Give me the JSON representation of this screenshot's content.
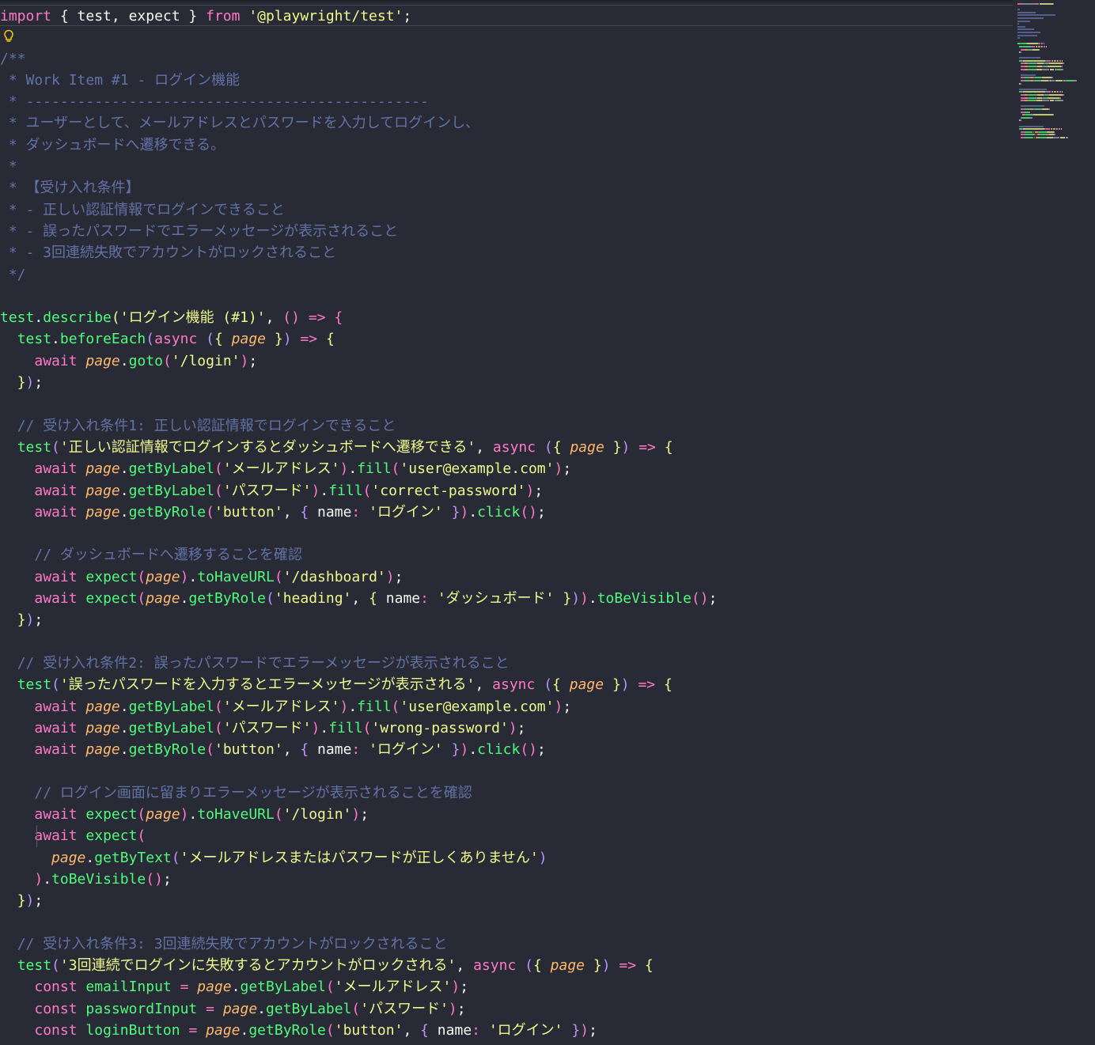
{
  "editor": {
    "language": "typescript",
    "colors": {
      "background": "#282a36",
      "comment": "#6272a4",
      "keyword": "#ff79c6",
      "string": "#f1fa8c",
      "function": "#50fa7b",
      "parameter": "#ffb86c",
      "foreground": "#f8f8f2"
    },
    "lightbulb_icon": "lightbulb-icon",
    "lines": [
      [
        [
          "k",
          "import"
        ],
        [
          "t",
          " { test, expect } "
        ],
        [
          "k",
          "from"
        ],
        [
          "t",
          " "
        ],
        [
          "s",
          "'@playwright/test'"
        ],
        [
          "t",
          ";"
        ]
      ],
      [],
      [
        [
          "c",
          "/**"
        ]
      ],
      [
        [
          "c",
          " * Work Item #1 - ログイン機能"
        ]
      ],
      [
        [
          "c",
          " * -----------------------------------------------"
        ]
      ],
      [
        [
          "c",
          " * ユーザーとして、メールアドレスとパスワードを入力してログインし、"
        ]
      ],
      [
        [
          "c",
          " * ダッシュボードへ遷移できる。"
        ]
      ],
      [
        [
          "c",
          " *"
        ]
      ],
      [
        [
          "c",
          " * 【受け入れ条件】"
        ]
      ],
      [
        [
          "c",
          " * - 正しい認証情報でログインできること"
        ]
      ],
      [
        [
          "c",
          " * - 誤ったパスワードでエラーメッセージが表示されること"
        ]
      ],
      [
        [
          "c",
          " * - 3回連続失敗でアカウントがロックされること"
        ]
      ],
      [
        [
          "c",
          " */"
        ]
      ],
      [],
      [
        [
          "f",
          "test"
        ],
        [
          "t",
          "."
        ],
        [
          "f",
          "describe"
        ],
        [
          "b1",
          "("
        ],
        [
          "s",
          "'ログイン機能 (#1)'"
        ],
        [
          "t",
          ", "
        ],
        [
          "b2",
          "()"
        ],
        [
          "t",
          " "
        ],
        [
          "k",
          "=>"
        ],
        [
          "t",
          " "
        ],
        [
          "b2",
          "{"
        ]
      ],
      [
        [
          "t",
          "  "
        ],
        [
          "f",
          "test"
        ],
        [
          "t",
          "."
        ],
        [
          "f",
          "beforeEach"
        ],
        [
          "b3",
          "("
        ],
        [
          "k",
          "async"
        ],
        [
          "t",
          " "
        ],
        [
          "b3",
          "("
        ],
        [
          "y",
          "{"
        ],
        [
          "t",
          " "
        ],
        [
          "p",
          "page"
        ],
        [
          "t",
          " "
        ],
        [
          "y",
          "}"
        ],
        [
          "b3",
          ")"
        ],
        [
          "t",
          " "
        ],
        [
          "k",
          "=>"
        ],
        [
          "t",
          " "
        ],
        [
          "y",
          "{"
        ]
      ],
      [
        [
          "t",
          "    "
        ],
        [
          "k",
          "await"
        ],
        [
          "t",
          " "
        ],
        [
          "p",
          "page"
        ],
        [
          "t",
          "."
        ],
        [
          "f",
          "goto"
        ],
        [
          "b2",
          "("
        ],
        [
          "s",
          "'/login'"
        ],
        [
          "b2",
          ")"
        ],
        [
          "t",
          ";"
        ]
      ],
      [
        [
          "t",
          "  "
        ],
        [
          "y",
          "}"
        ],
        [
          "b3",
          ")"
        ],
        [
          "t",
          ";"
        ]
      ],
      [],
      [
        [
          "t",
          "  "
        ],
        [
          "c",
          "// 受け入れ条件1: 正しい認証情報でログインできること"
        ]
      ],
      [
        [
          "t",
          "  "
        ],
        [
          "f",
          "test"
        ],
        [
          "b3",
          "("
        ],
        [
          "s",
          "'正しい認証情報でログインするとダッシュボードへ遷移できる'"
        ],
        [
          "t",
          ", "
        ],
        [
          "k",
          "async"
        ],
        [
          "t",
          " "
        ],
        [
          "b3",
          "("
        ],
        [
          "y",
          "{"
        ],
        [
          "t",
          " "
        ],
        [
          "p",
          "page"
        ],
        [
          "t",
          " "
        ],
        [
          "y",
          "}"
        ],
        [
          "b3",
          ")"
        ],
        [
          "t",
          " "
        ],
        [
          "k",
          "=>"
        ],
        [
          "t",
          " "
        ],
        [
          "y",
          "{"
        ]
      ],
      [
        [
          "t",
          "    "
        ],
        [
          "k",
          "await"
        ],
        [
          "t",
          " "
        ],
        [
          "p",
          "page"
        ],
        [
          "t",
          "."
        ],
        [
          "f",
          "getByLabel"
        ],
        [
          "b2",
          "("
        ],
        [
          "s",
          "'メールアドレス'"
        ],
        [
          "b2",
          ")"
        ],
        [
          "t",
          "."
        ],
        [
          "f",
          "fill"
        ],
        [
          "b2",
          "("
        ],
        [
          "s",
          "'user@example.com'"
        ],
        [
          "b2",
          ")"
        ],
        [
          "t",
          ";"
        ]
      ],
      [
        [
          "t",
          "    "
        ],
        [
          "k",
          "await"
        ],
        [
          "t",
          " "
        ],
        [
          "p",
          "page"
        ],
        [
          "t",
          "."
        ],
        [
          "f",
          "getByLabel"
        ],
        [
          "b2",
          "("
        ],
        [
          "s",
          "'パスワード'"
        ],
        [
          "b2",
          ")"
        ],
        [
          "t",
          "."
        ],
        [
          "f",
          "fill"
        ],
        [
          "b2",
          "("
        ],
        [
          "s",
          "'correct-password'"
        ],
        [
          "b2",
          ")"
        ],
        [
          "t",
          ";"
        ]
      ],
      [
        [
          "t",
          "    "
        ],
        [
          "k",
          "await"
        ],
        [
          "t",
          " "
        ],
        [
          "p",
          "page"
        ],
        [
          "t",
          "."
        ],
        [
          "f",
          "getByRole"
        ],
        [
          "b2",
          "("
        ],
        [
          "s",
          "'button'"
        ],
        [
          "t",
          ", "
        ],
        [
          "b3",
          "{"
        ],
        [
          "t",
          " name"
        ],
        [
          "k",
          ":"
        ],
        [
          "t",
          " "
        ],
        [
          "s",
          "'ログイン'"
        ],
        [
          "t",
          " "
        ],
        [
          "b3",
          "}"
        ],
        [
          "b2",
          ")"
        ],
        [
          "t",
          "."
        ],
        [
          "f",
          "click"
        ],
        [
          "b2",
          "()"
        ],
        [
          "t",
          ";"
        ]
      ],
      [],
      [
        [
          "t",
          "    "
        ],
        [
          "c",
          "// ダッシュボードへ遷移することを確認"
        ]
      ],
      [
        [
          "t",
          "    "
        ],
        [
          "k",
          "await"
        ],
        [
          "t",
          " "
        ],
        [
          "f",
          "expect"
        ],
        [
          "b2",
          "("
        ],
        [
          "p",
          "page"
        ],
        [
          "b2",
          ")"
        ],
        [
          "t",
          "."
        ],
        [
          "f",
          "toHaveURL"
        ],
        [
          "b2",
          "("
        ],
        [
          "s",
          "'/dashboard'"
        ],
        [
          "b2",
          ")"
        ],
        [
          "t",
          ";"
        ]
      ],
      [
        [
          "t",
          "    "
        ],
        [
          "k",
          "await"
        ],
        [
          "t",
          " "
        ],
        [
          "f",
          "expect"
        ],
        [
          "b2",
          "("
        ],
        [
          "p",
          "page"
        ],
        [
          "t",
          "."
        ],
        [
          "f",
          "getByRole"
        ],
        [
          "b3",
          "("
        ],
        [
          "s",
          "'heading'"
        ],
        [
          "t",
          ", "
        ],
        [
          "y",
          "{"
        ],
        [
          "t",
          " name"
        ],
        [
          "k",
          ":"
        ],
        [
          "t",
          " "
        ],
        [
          "s",
          "'ダッシュボード'"
        ],
        [
          "t",
          " "
        ],
        [
          "y",
          "}"
        ],
        [
          "b3",
          ")"
        ],
        [
          "b2",
          ")"
        ],
        [
          "t",
          "."
        ],
        [
          "f",
          "toBeVisible"
        ],
        [
          "b2",
          "()"
        ],
        [
          "t",
          ";"
        ]
      ],
      [
        [
          "t",
          "  "
        ],
        [
          "y",
          "}"
        ],
        [
          "b3",
          ")"
        ],
        [
          "t",
          ";"
        ]
      ],
      [],
      [
        [
          "t",
          "  "
        ],
        [
          "c",
          "// 受け入れ条件2: 誤ったパスワードでエラーメッセージが表示されること"
        ]
      ],
      [
        [
          "t",
          "  "
        ],
        [
          "f",
          "test"
        ],
        [
          "b3",
          "("
        ],
        [
          "s",
          "'誤ったパスワードを入力するとエラーメッセージが表示される'"
        ],
        [
          "t",
          ", "
        ],
        [
          "k",
          "async"
        ],
        [
          "t",
          " "
        ],
        [
          "b3",
          "("
        ],
        [
          "y",
          "{"
        ],
        [
          "t",
          " "
        ],
        [
          "p",
          "page"
        ],
        [
          "t",
          " "
        ],
        [
          "y",
          "}"
        ],
        [
          "b3",
          ")"
        ],
        [
          "t",
          " "
        ],
        [
          "k",
          "=>"
        ],
        [
          "t",
          " "
        ],
        [
          "y",
          "{"
        ]
      ],
      [
        [
          "t",
          "    "
        ],
        [
          "k",
          "await"
        ],
        [
          "t",
          " "
        ],
        [
          "p",
          "page"
        ],
        [
          "t",
          "."
        ],
        [
          "f",
          "getByLabel"
        ],
        [
          "b2",
          "("
        ],
        [
          "s",
          "'メールアドレス'"
        ],
        [
          "b2",
          ")"
        ],
        [
          "t",
          "."
        ],
        [
          "f",
          "fill"
        ],
        [
          "b2",
          "("
        ],
        [
          "s",
          "'user@example.com'"
        ],
        [
          "b2",
          ")"
        ],
        [
          "t",
          ";"
        ]
      ],
      [
        [
          "t",
          "    "
        ],
        [
          "k",
          "await"
        ],
        [
          "t",
          " "
        ],
        [
          "p",
          "page"
        ],
        [
          "t",
          "."
        ],
        [
          "f",
          "getByLabel"
        ],
        [
          "b2",
          "("
        ],
        [
          "s",
          "'パスワード'"
        ],
        [
          "b2",
          ")"
        ],
        [
          "t",
          "."
        ],
        [
          "f",
          "fill"
        ],
        [
          "b2",
          "("
        ],
        [
          "s",
          "'wrong-password'"
        ],
        [
          "b2",
          ")"
        ],
        [
          "t",
          ";"
        ]
      ],
      [
        [
          "t",
          "    "
        ],
        [
          "k",
          "await"
        ],
        [
          "t",
          " "
        ],
        [
          "p",
          "page"
        ],
        [
          "t",
          "."
        ],
        [
          "f",
          "getByRole"
        ],
        [
          "b2",
          "("
        ],
        [
          "s",
          "'button'"
        ],
        [
          "t",
          ", "
        ],
        [
          "b3",
          "{"
        ],
        [
          "t",
          " name"
        ],
        [
          "k",
          ":"
        ],
        [
          "t",
          " "
        ],
        [
          "s",
          "'ログイン'"
        ],
        [
          "t",
          " "
        ],
        [
          "b3",
          "}"
        ],
        [
          "b2",
          ")"
        ],
        [
          "t",
          "."
        ],
        [
          "f",
          "click"
        ],
        [
          "b2",
          "()"
        ],
        [
          "t",
          ";"
        ]
      ],
      [],
      [
        [
          "t",
          "    "
        ],
        [
          "c",
          "// ログイン画面に留まりエラーメッセージが表示されることを確認"
        ]
      ],
      [
        [
          "t",
          "    "
        ],
        [
          "k",
          "await"
        ],
        [
          "t",
          " "
        ],
        [
          "f",
          "expect"
        ],
        [
          "b2",
          "("
        ],
        [
          "p",
          "page"
        ],
        [
          "b2",
          ")"
        ],
        [
          "t",
          "."
        ],
        [
          "f",
          "toHaveURL"
        ],
        [
          "b2",
          "("
        ],
        [
          "s",
          "'/login'"
        ],
        [
          "b2",
          ")"
        ],
        [
          "t",
          ";"
        ]
      ],
      [
        [
          "t",
          "    "
        ],
        [
          "k",
          "await"
        ],
        [
          "t",
          " "
        ],
        [
          "f",
          "expect"
        ],
        [
          "b2",
          "("
        ]
      ],
      [
        [
          "t",
          "      "
        ],
        [
          "p",
          "page"
        ],
        [
          "t",
          "."
        ],
        [
          "f",
          "getByText"
        ],
        [
          "b3",
          "("
        ],
        [
          "s",
          "'メールアドレスまたはパスワードが正しくありません'"
        ],
        [
          "b3",
          ")"
        ]
      ],
      [
        [
          "t",
          "    "
        ],
        [
          "b2",
          ")"
        ],
        [
          "t",
          "."
        ],
        [
          "f",
          "toBeVisible"
        ],
        [
          "b2",
          "()"
        ],
        [
          "t",
          ";"
        ]
      ],
      [
        [
          "t",
          "  "
        ],
        [
          "y",
          "}"
        ],
        [
          "b3",
          ")"
        ],
        [
          "t",
          ";"
        ]
      ],
      [],
      [
        [
          "t",
          "  "
        ],
        [
          "c",
          "// 受け入れ条件3: 3回連続失敗でアカウントがロックされること"
        ]
      ],
      [
        [
          "t",
          "  "
        ],
        [
          "f",
          "test"
        ],
        [
          "b3",
          "("
        ],
        [
          "s",
          "'3回連続でログインに失敗するとアカウントがロックされる'"
        ],
        [
          "t",
          ", "
        ],
        [
          "k",
          "async"
        ],
        [
          "t",
          " "
        ],
        [
          "b3",
          "("
        ],
        [
          "y",
          "{"
        ],
        [
          "t",
          " "
        ],
        [
          "p",
          "page"
        ],
        [
          "t",
          " "
        ],
        [
          "y",
          "}"
        ],
        [
          "b3",
          ")"
        ],
        [
          "t",
          " "
        ],
        [
          "k",
          "=>"
        ],
        [
          "t",
          " "
        ],
        [
          "y",
          "{"
        ]
      ],
      [
        [
          "t",
          "    "
        ],
        [
          "k",
          "const"
        ],
        [
          "t",
          " "
        ],
        [
          "f",
          "emailInput"
        ],
        [
          "t",
          " "
        ],
        [
          "k",
          "="
        ],
        [
          "t",
          " "
        ],
        [
          "p",
          "page"
        ],
        [
          "t",
          "."
        ],
        [
          "f",
          "getByLabel"
        ],
        [
          "b2",
          "("
        ],
        [
          "s",
          "'メールアドレス'"
        ],
        [
          "b2",
          ")"
        ],
        [
          "t",
          ";"
        ]
      ],
      [
        [
          "t",
          "    "
        ],
        [
          "k",
          "const"
        ],
        [
          "t",
          " "
        ],
        [
          "f",
          "passwordInput"
        ],
        [
          "t",
          " "
        ],
        [
          "k",
          "="
        ],
        [
          "t",
          " "
        ],
        [
          "p",
          "page"
        ],
        [
          "t",
          "."
        ],
        [
          "f",
          "getByLabel"
        ],
        [
          "b2",
          "("
        ],
        [
          "s",
          "'パスワード'"
        ],
        [
          "b2",
          ")"
        ],
        [
          "t",
          ";"
        ]
      ],
      [
        [
          "t",
          "    "
        ],
        [
          "k",
          "const"
        ],
        [
          "t",
          " "
        ],
        [
          "f",
          "loginButton"
        ],
        [
          "t",
          " "
        ],
        [
          "k",
          "="
        ],
        [
          "t",
          " "
        ],
        [
          "p",
          "page"
        ],
        [
          "t",
          "."
        ],
        [
          "f",
          "getByRole"
        ],
        [
          "b2",
          "("
        ],
        [
          "s",
          "'button'"
        ],
        [
          "t",
          ", "
        ],
        [
          "b3",
          "{"
        ],
        [
          "t",
          " name"
        ],
        [
          "k",
          ":"
        ],
        [
          "t",
          " "
        ],
        [
          "s",
          "'ログイン'"
        ],
        [
          "t",
          " "
        ],
        [
          "b3",
          "}"
        ],
        [
          "b2",
          ")"
        ],
        [
          "t",
          ";"
        ]
      ]
    ]
  }
}
